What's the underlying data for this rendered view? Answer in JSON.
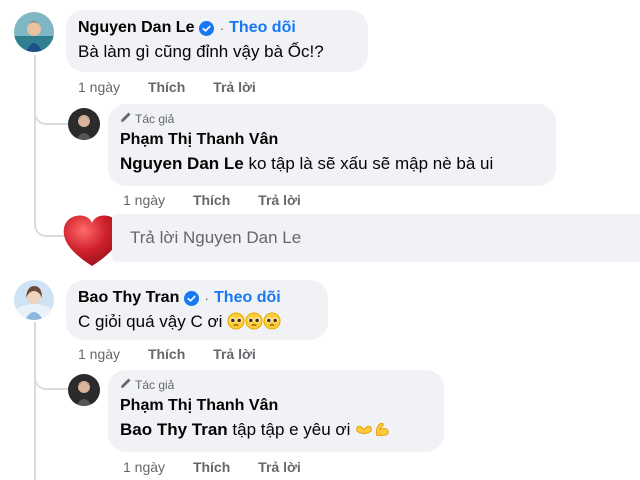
{
  "colors": {
    "accent": "#1877f2",
    "bubble": "#f0f2f5",
    "muted": "#65676b",
    "heart": "#c8202a"
  },
  "comments": [
    {
      "author": "Nguyen Dan Le",
      "verified": true,
      "follow_label": "Theo dõi",
      "text": "Bà làm gì cũng đỉnh vậy bà Ốc!?",
      "time": "1 ngày",
      "like_label": "Thích",
      "reply_label": "Trả lời",
      "replies": [
        {
          "author_tag": "Tác giả",
          "author": "Phạm Thị Thanh Vân",
          "mention": "Nguyen Dan Le",
          "text": " ko tập là sẽ xấu sẽ mập nè bà ui",
          "time": "1 ngày",
          "like_label": "Thích",
          "reply_label": "Trả lời"
        }
      ],
      "reply_input_placeholder": "Trả lời Nguyen Dan Le"
    },
    {
      "author": "Bao Thy Tran",
      "verified": true,
      "follow_label": "Theo dõi",
      "text": "C giỏi quá vậy C ơi",
      "text_emojis": [
        "pleading-face",
        "pleading-face",
        "pleading-face"
      ],
      "time": "1 ngày",
      "like_label": "Thích",
      "reply_label": "Trả lời",
      "replies": [
        {
          "author_tag": "Tác giả",
          "author": "Phạm Thị Thanh Vân",
          "mention": "Bao Thy Tran",
          "text": " tập tập e yêu ơi",
          "text_emojis": [
            "heart-hands",
            "flexed-biceps"
          ],
          "time": "1 ngày",
          "like_label": "Thích",
          "reply_label": "Trả lời"
        }
      ]
    }
  ]
}
